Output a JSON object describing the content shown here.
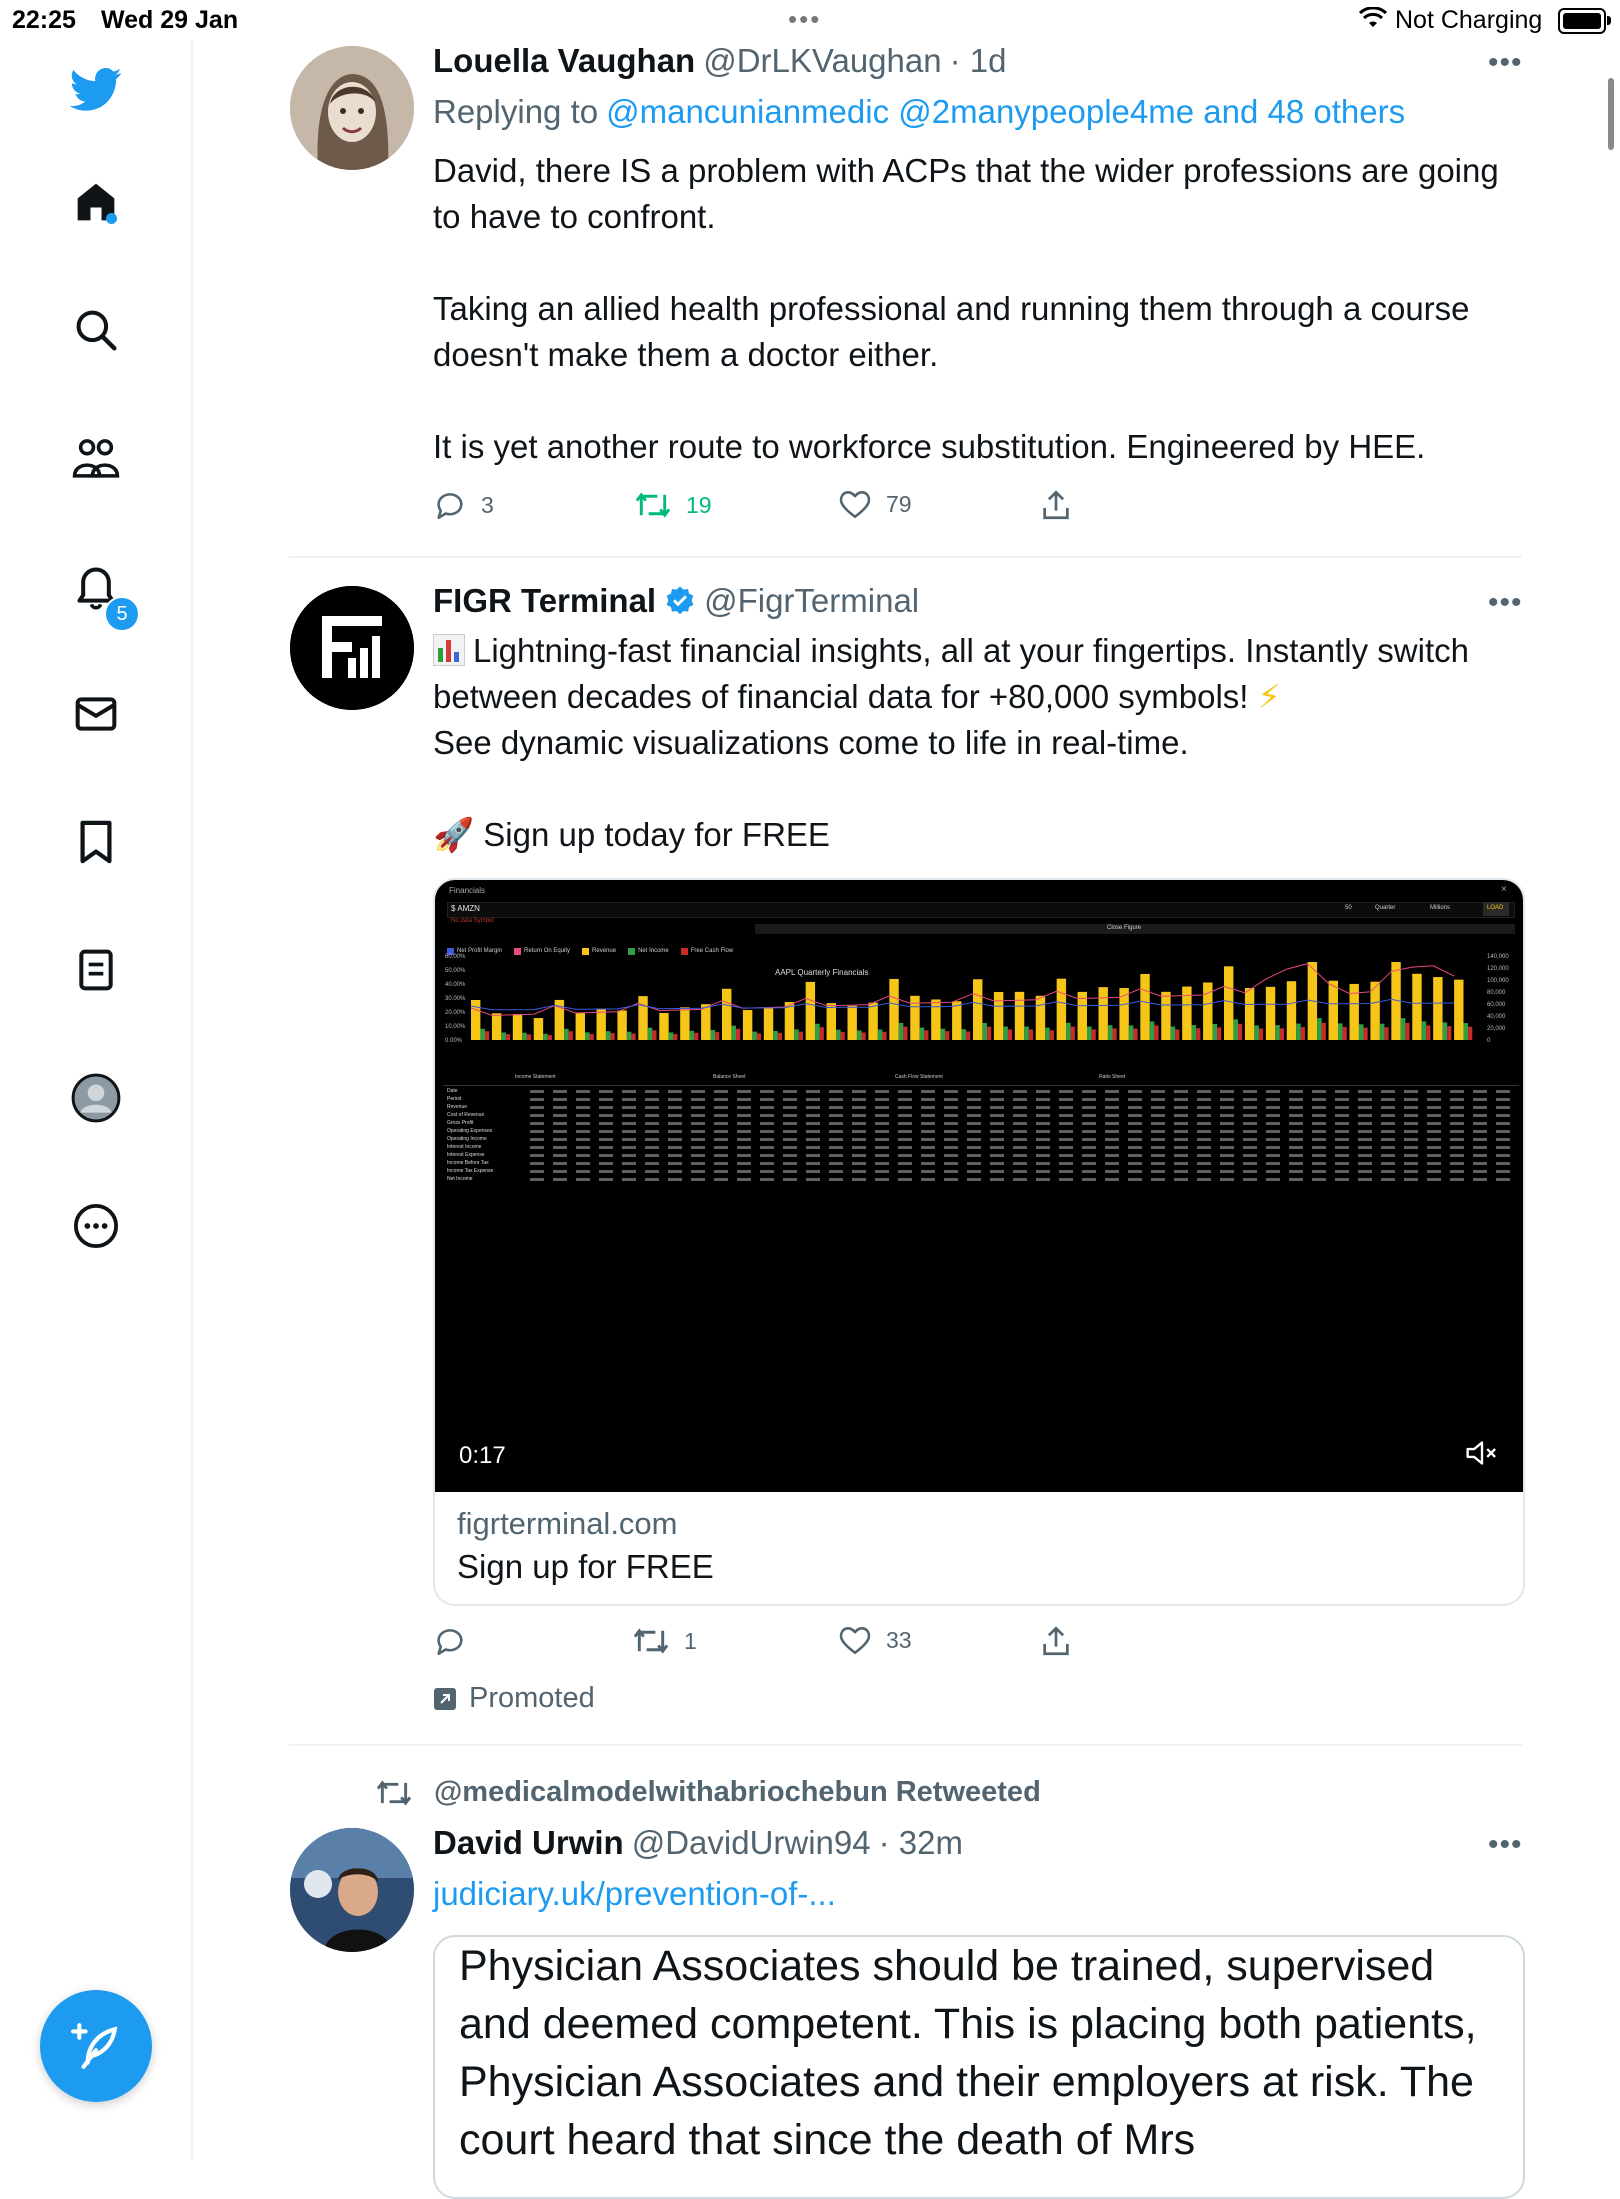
{
  "status_bar": {
    "time": "22:25",
    "date": "Wed 29 Jan",
    "multitask_dots": "•••",
    "charging": "Not Charging"
  },
  "sidebar": {
    "notification_count": "5",
    "items": [
      "twitter-logo",
      "home",
      "explore",
      "communities",
      "notifications",
      "messages",
      "bookmarks",
      "lists",
      "profile",
      "more"
    ]
  },
  "tweet1": {
    "name": "Louella Vaughan",
    "handle": "@DrLKVaughan",
    "time": "· 1d",
    "replying_prefix": "Replying to",
    "replying_to": "@mancunianmedic @2manypeople4me and 48 others",
    "text": "David, there IS a problem with ACPs that the wider professions are going to have to confront.\n\nTaking an allied health professional and running them through a course doesn't make them a doctor either.\n\nIt is yet another route to workforce substitution. Engineered by HEE.",
    "replies": "3",
    "retweets": "19",
    "likes": "79"
  },
  "tweet2": {
    "name": "FIGR Terminal",
    "handle": "@FigrTerminal",
    "text_line1": "Lightning-fast financial insights, all at your fingertips. Instantly switch between decades of financial data for +80,000 symbols! ",
    "text_line2": "See dynamic visualizations come to life in real-time.",
    "text_line3": "Sign up today for FREE",
    "video_time": "0:17",
    "card_domain": "figrterminal.com",
    "card_title": "Sign up for FREE",
    "replies": "",
    "retweets": "1",
    "likes": "33",
    "promoted": "Promoted",
    "video": {
      "window_title": "Financials",
      "symbol": "$ AMZN",
      "symbol_hint": "No data Symbol",
      "close_label": "Close Figure",
      "controls": [
        "50",
        "Quarter",
        "Millions",
        "LOAD"
      ],
      "legend": [
        "Net Profit Margin",
        "Return On Equity",
        "Revenue",
        "Net Income",
        "Free Cash Flow"
      ],
      "chart_title": "AAPL Quarterly Financials",
      "left_axis": [
        "60.00%",
        "50.00%",
        "40.00%",
        "30.00%",
        "20.00%",
        "10.00%",
        "0.00%"
      ],
      "right_axis": [
        "140,000",
        "120,000",
        "100,000",
        "80,000",
        "60,000",
        "40,000",
        "20,000",
        "0"
      ],
      "sections": [
        "Income Statement",
        "Balance Sheet",
        "Cash Flow Statement",
        "Ratio Sheet"
      ],
      "row_labels": [
        "Date",
        "Period",
        "Revenue",
        "Cost of Revenue",
        "Gross Profit",
        "Operating Expenses",
        "Operating Income",
        "Interest Income",
        "Interest Expense",
        "Income Before Tax",
        "Income Tax Expense",
        "Net Income"
      ]
    }
  },
  "tweet3": {
    "retweeted_by": "@medicalmodelwithabriochebun Retweeted",
    "name": "David Urwin",
    "handle": "@DavidUrwin94",
    "time": "· 32m",
    "link": "judiciary.uk/prevention-of-...",
    "quote_text": "Physician Associates should be trained, supervised and deemed competent. This is placing both patients, Physician Associates and their employers at risk. The court heard that since the death of Mrs"
  },
  "colors": {
    "twitter_blue": "#1d9bf0",
    "retweet_green": "#00ba7c",
    "secondary_text": "#536471"
  }
}
